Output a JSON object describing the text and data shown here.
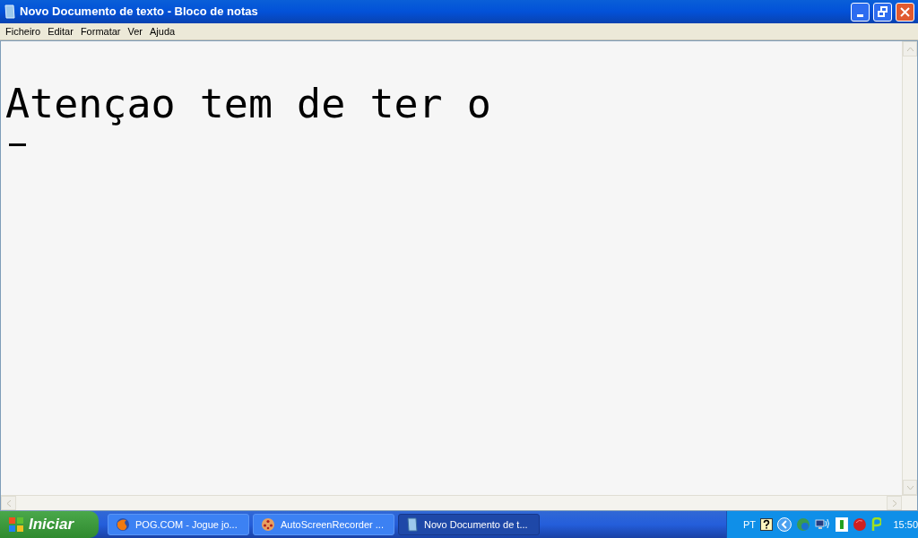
{
  "window": {
    "title": "Novo Documento de texto - Bloco de notas"
  },
  "menu": [
    "Ficheiro",
    "Editar",
    "Formatar",
    "Ver",
    "Ajuda"
  ],
  "editor": {
    "text": "Atençao tem de ter o"
  },
  "taskbar": {
    "start": "Iniciar",
    "buttons": [
      {
        "label": "POG.COM - Jogue jo...",
        "kind": "browser",
        "selected": false
      },
      {
        "label": "AutoScreenRecorder ...",
        "kind": "recorder",
        "selected": false
      },
      {
        "label": "Novo Documento de t...",
        "kind": "notepad",
        "selected": true
      }
    ],
    "language": "PT",
    "clock": "15:50"
  }
}
